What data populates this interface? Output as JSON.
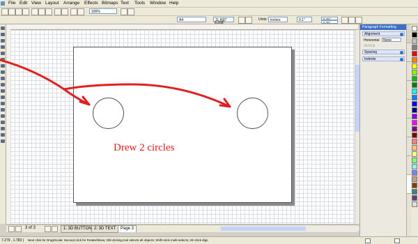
{
  "menu": [
    "File",
    "Edit",
    "View",
    "Layout",
    "Arrange",
    "Effects",
    "Bitmaps",
    "Text",
    "Tools",
    "Window",
    "Help"
  ],
  "toolbar": {
    "zoom": "100%"
  },
  "propbar": {
    "paper": "A4",
    "width": "11.693\"",
    "height": "8.268\"",
    "units_label": "Units:",
    "units": "inches",
    "nudge": "0.1\"",
    "dup_x": "0.25\"",
    "dup_y": "0.25\""
  },
  "canvas": {
    "annotation": "Drew 2 circles"
  },
  "annotation_color": "#e02020",
  "page_nav": {
    "page_count": "3 of 3",
    "tabs": [
      "1: 3D BUTTON",
      "2: 3D TEXT",
      "Page 3"
    ],
    "active_tab": "Page 3"
  },
  "status": {
    "coords": "7.279 , 1.783 )",
    "hint": "Next click for Drag/Scale; Second click for Rotate/Skew; Dbl-clicking tool selects all objects; Shift+click multi-selects; Alt+click digs"
  },
  "panel": {
    "title": "Paragraph Formatting",
    "sections": {
      "alignment": "Alignment",
      "spacing": "Spacing",
      "indents": "Indents"
    },
    "horizontal_label": "Horizontal",
    "horizontal_value": "None",
    "vertical_label": "Vertical"
  },
  "palette_colors": [
    "#ffffff",
    "#000000",
    "#c0c0c0",
    "#808080",
    "#ff0000",
    "#ff8000",
    "#ffff00",
    "#80ff00",
    "#00c000",
    "#008000",
    "#00ffff",
    "#0080ff",
    "#0000ff",
    "#000080",
    "#8000ff",
    "#ff00ff",
    "#800080",
    "#800000",
    "#ff8080",
    "#ffc080",
    "#ffff80",
    "#80ff80",
    "#80ffff",
    "#8080ff",
    "#c0a080",
    "#804000",
    "#408080",
    "#604080",
    "#e0e0e0"
  ]
}
